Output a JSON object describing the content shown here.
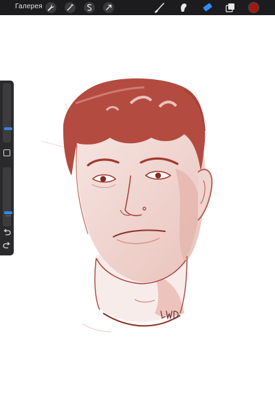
{
  "toolbar": {
    "gallery_label": "Галерея",
    "actions": [
      {
        "icon": "wrench-icon"
      },
      {
        "icon": "magic-wand-icon"
      },
      {
        "icon": "selection-icon"
      },
      {
        "icon": "transform-arrow-icon"
      }
    ],
    "tools": [
      {
        "icon": "brush-icon"
      },
      {
        "icon": "smudge-icon"
      },
      {
        "icon": "eraser-icon"
      },
      {
        "icon": "layers-icon"
      }
    ],
    "active_tool": "eraser-icon",
    "current_color": "#9e1a12",
    "accent_color": "#2f8cff"
  },
  "sidebar": {
    "brush_size_level": 0.22,
    "opacity_level": 0.22,
    "buttons": [
      {
        "icon": "modify-square-icon"
      },
      {
        "icon": "undo-icon"
      },
      {
        "icon": "redo-icon"
      }
    ]
  },
  "canvas": {
    "artwork": "sketch-portrait",
    "stroke_color": "#a8463c",
    "signature": "LWD"
  }
}
